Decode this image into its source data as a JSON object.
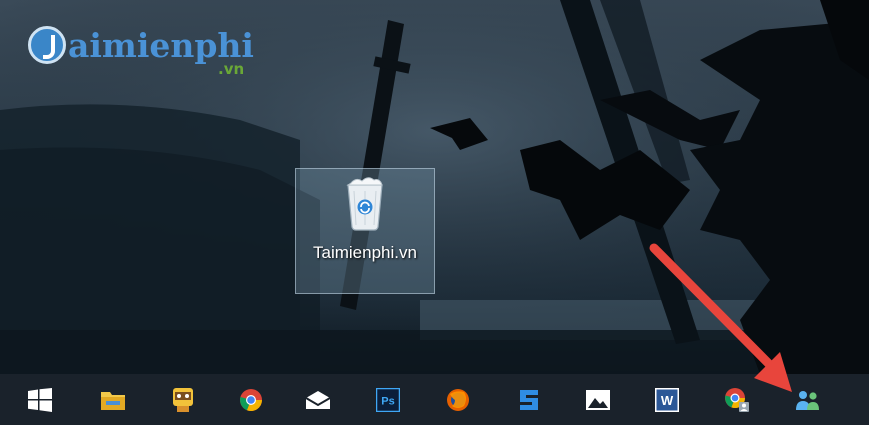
{
  "watermark": {
    "brand": "aimienphi",
    "tld": ".vn",
    "badge_letter": "T"
  },
  "desktop": {
    "recycle_bin": {
      "icon": "recycle-bin-icon",
      "label": "Taimienphi.vn"
    }
  },
  "taskbar": {
    "items": [
      {
        "name": "start-button",
        "icon": "windows-logo-icon"
      },
      {
        "name": "file-explorer-button",
        "icon": "folder-icon"
      },
      {
        "name": "app-button",
        "icon": "character-icon"
      },
      {
        "name": "chrome-button",
        "icon": "chrome-icon"
      },
      {
        "name": "mail-button",
        "icon": "mail-envelope-icon"
      },
      {
        "name": "photoshop-button",
        "icon": "photoshop-icon",
        "text": "Ps"
      },
      {
        "name": "firefox-button",
        "icon": "firefox-icon"
      },
      {
        "name": "app-s-button",
        "icon": "s-app-icon"
      },
      {
        "name": "photos-button",
        "icon": "photos-icon"
      },
      {
        "name": "word-button",
        "icon": "word-icon",
        "text": "W"
      },
      {
        "name": "chrome-profile-button",
        "icon": "chrome-user-icon"
      },
      {
        "name": "people-button",
        "icon": "people-icon"
      }
    ]
  },
  "colors": {
    "taskbar": "#1a222b",
    "arrow": "#e8453c",
    "logo_blue": "#4a92d6",
    "logo_green": "#6aa837"
  }
}
